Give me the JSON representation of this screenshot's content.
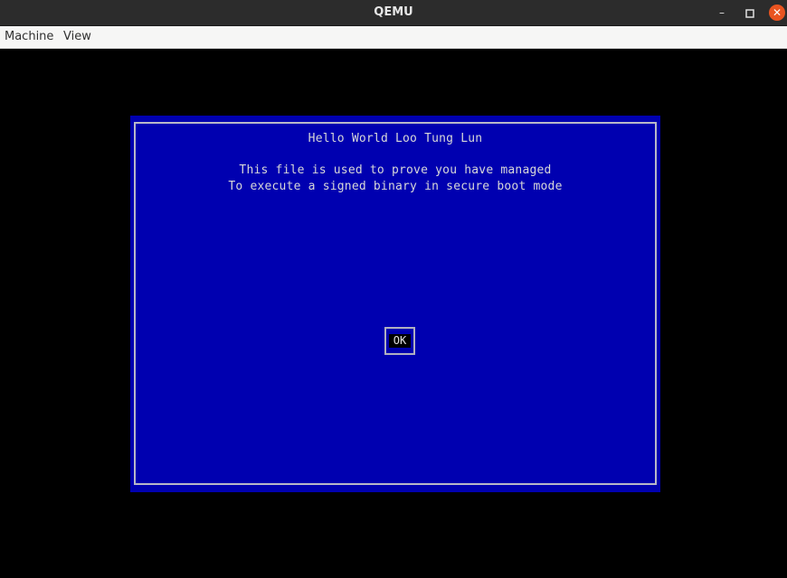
{
  "window": {
    "title": "QEMU",
    "controls": {
      "minimize_icon": "minimize-icon",
      "maximize_icon": "maximize-icon",
      "close_icon": "close-icon",
      "close_color": "#e95420"
    }
  },
  "menubar": {
    "items": [
      {
        "label": "Machine"
      },
      {
        "label": "View"
      }
    ]
  },
  "dialog": {
    "title": "Hello World Loo Tung Lun",
    "line1": "This file is used to prove you have managed",
    "line2": "To execute a signed binary in secure boot mode",
    "ok_label": "OK",
    "background_color": "#0000b0"
  }
}
